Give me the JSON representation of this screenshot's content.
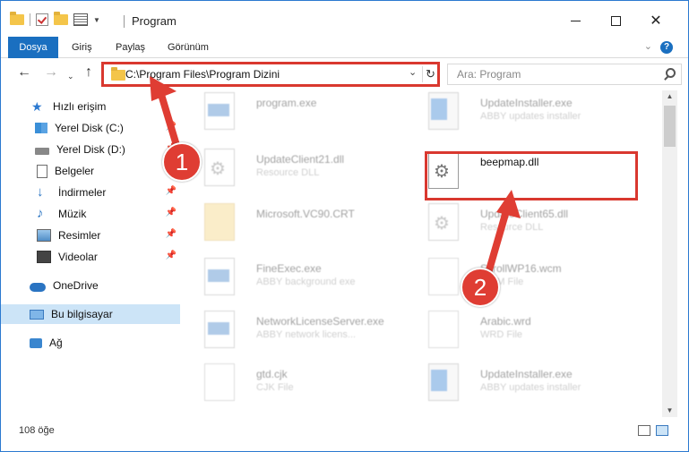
{
  "window": {
    "title": "Program"
  },
  "ribbon": {
    "tabs": [
      "Dosya",
      "Giriş",
      "Paylaş",
      "Görünüm"
    ]
  },
  "address": {
    "path": "C:\\Program Files\\Program Dizini"
  },
  "search": {
    "placeholder": "Ara: Program"
  },
  "sidebar": {
    "items": [
      {
        "label": "Hızlı erişim",
        "icon": "star-icon"
      },
      {
        "label": "Yerel Disk (C:)",
        "icon": "drive-icon",
        "pinned": true
      },
      {
        "label": "Yerel Disk (D:)",
        "icon": "drive-icon",
        "pinned": true
      },
      {
        "label": "Belgeler",
        "icon": "documents-icon",
        "pinned": true
      },
      {
        "label": "İndirmeler",
        "icon": "downloads-icon",
        "pinned": true
      },
      {
        "label": "Müzik",
        "icon": "music-icon",
        "pinned": true
      },
      {
        "label": "Resimler",
        "icon": "pictures-icon",
        "pinned": true
      },
      {
        "label": "Videolar",
        "icon": "videos-icon",
        "pinned": true
      },
      {
        "label": "OneDrive",
        "icon": "onedrive-icon"
      },
      {
        "label": "Bu bilgisayar",
        "icon": "pc-icon",
        "selected": true
      },
      {
        "label": "Ağ",
        "icon": "network-icon"
      }
    ]
  },
  "files": [
    {
      "name": "program.exe",
      "sub": "",
      "icon": "app-icon"
    },
    {
      "name": "UpdateInstaller.exe",
      "sub": "ABBY updates installer",
      "icon": "installer-icon"
    },
    {
      "name": "UpdateClient21.dll",
      "sub": "Resource DLL",
      "icon": "dll-icon"
    },
    {
      "name": "beepmap.dll",
      "sub": "",
      "icon": "dll-icon"
    },
    {
      "name": "Microsoft.VC90.CRT",
      "sub": "",
      "icon": "folder-icon"
    },
    {
      "name": "UpdateClient65.dll",
      "sub": "Resource DLL",
      "icon": "dll-icon"
    },
    {
      "name": "FineExec.exe",
      "sub": "ABBY background exe",
      "icon": "app-icon"
    },
    {
      "name": "ScrollWP16.wcm",
      "sub": "WCM File",
      "icon": "file-icon"
    },
    {
      "name": "NetworkLicenseServer.exe",
      "sub": "ABBY network licens...",
      "icon": "app-icon"
    },
    {
      "name": "Arabic.wrd",
      "sub": "WRD File",
      "icon": "file-icon"
    },
    {
      "name": "gtd.cjk",
      "sub": "CJK File",
      "icon": "file-icon"
    },
    {
      "name": "UpdateInstaller.exe",
      "sub": "ABBY updates installer",
      "icon": "installer-icon"
    }
  ],
  "status": {
    "count": "108 öğe"
  },
  "annotations": {
    "step1": "1",
    "step2": "2"
  },
  "colors": {
    "accent": "#1a6fc0",
    "highlight": "#d9382f",
    "selection": "#cce4f7"
  }
}
